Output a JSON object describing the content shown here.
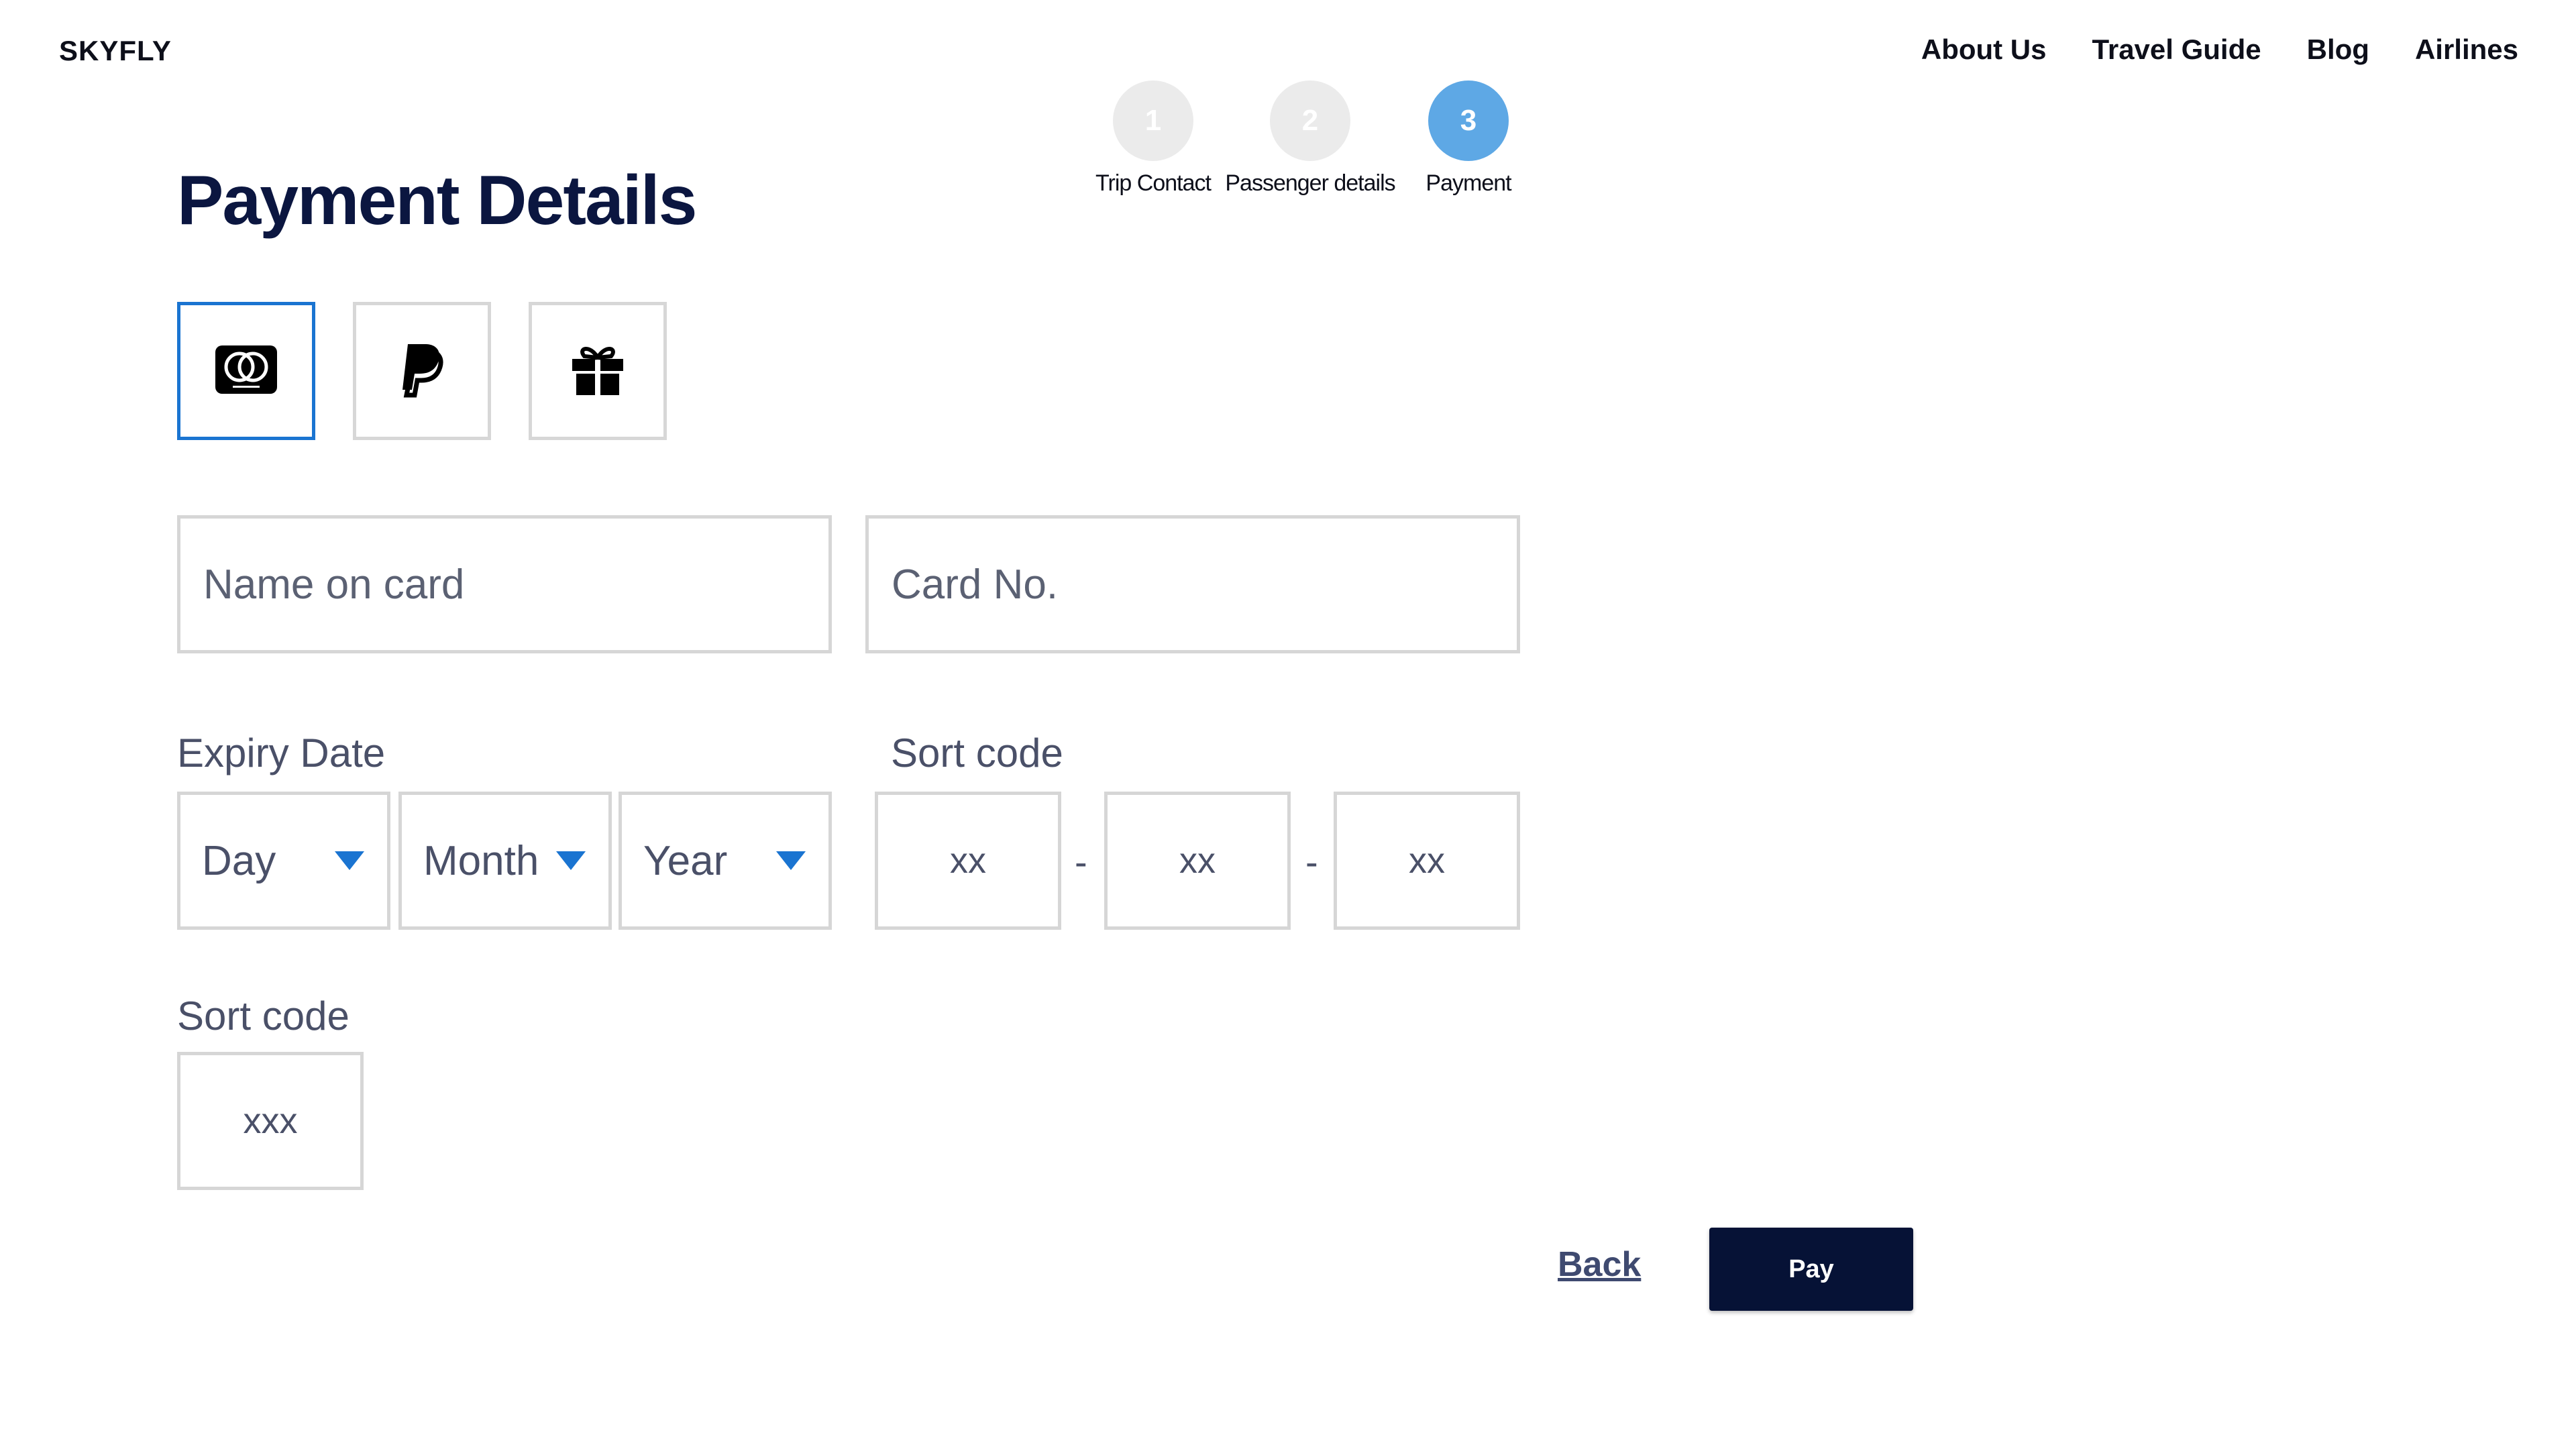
{
  "header": {
    "logo": "SKYFLY",
    "nav": [
      "About Us",
      "Travel Guide",
      "Blog",
      "Airlines"
    ]
  },
  "stepper": {
    "steps": [
      {
        "number": "1",
        "label": "Trip Contact",
        "active": false
      },
      {
        "number": "2",
        "label": "Passenger details",
        "active": false
      },
      {
        "number": "3",
        "label": "Payment",
        "active": true
      }
    ]
  },
  "page": {
    "title": "Payment Details"
  },
  "payment_methods": [
    {
      "icon": "mastercard-icon",
      "selected": true
    },
    {
      "icon": "paypal-icon",
      "selected": false
    },
    {
      "icon": "gift-icon",
      "selected": false
    }
  ],
  "form": {
    "name_on_card": {
      "placeholder": "Name on card",
      "value": ""
    },
    "card_number": {
      "placeholder": "Card No.",
      "value": ""
    },
    "expiry": {
      "label": "Expiry Date",
      "day": "Day",
      "month": "Month",
      "year": "Year"
    },
    "sort_code": {
      "label": "Sort code",
      "parts": [
        "xx",
        "xx",
        "xx"
      ],
      "separator": "-"
    },
    "security_code": {
      "label": "Sort code",
      "placeholder": "xxx"
    }
  },
  "actions": {
    "back_label": "Back",
    "pay_label": "Pay"
  },
  "colors": {
    "accent": "#1a74d1",
    "step_active": "#5ea8e5",
    "step_inactive": "#ebebeb",
    "primary_button": "#061236",
    "title": "#0b1640"
  }
}
